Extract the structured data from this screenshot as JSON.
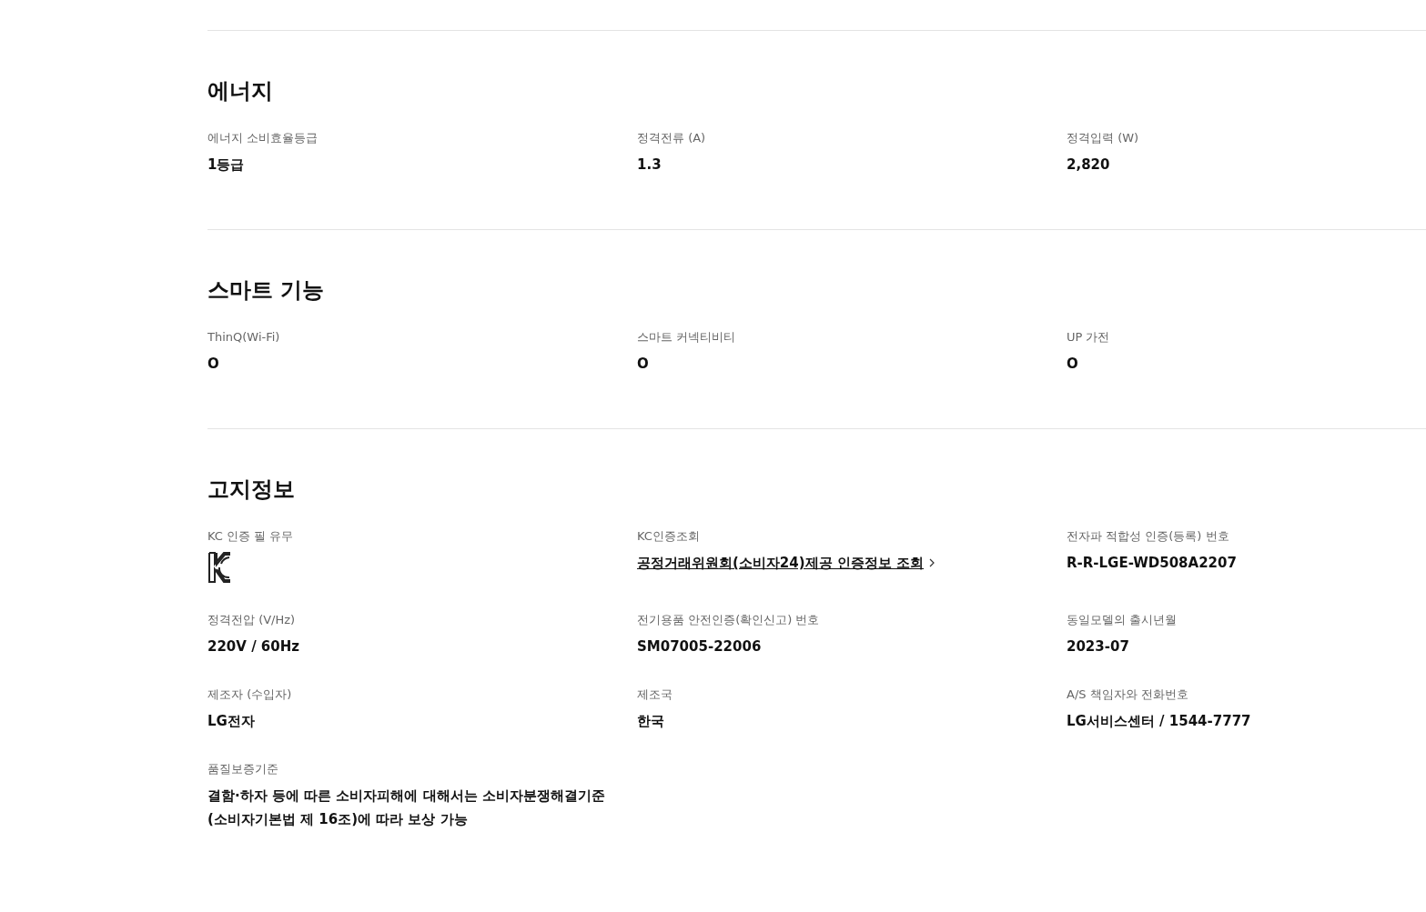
{
  "sections": [
    {
      "title": "에너지",
      "items": [
        {
          "kind": "text",
          "label": "에너지 소비효율등급",
          "value": "1등급"
        },
        {
          "kind": "text",
          "label": "정격전류 (A)",
          "value": "1.3"
        },
        {
          "kind": "text",
          "label": "정격입력 (W)",
          "value": "2,820"
        }
      ]
    },
    {
      "title": "스마트 기능",
      "items": [
        {
          "kind": "text",
          "label": "ThinQ(Wi-Fi)",
          "value": "O"
        },
        {
          "kind": "text",
          "label": "스마트 커넥티비티",
          "value": "O"
        },
        {
          "kind": "text",
          "label": "UP 가전",
          "value": "O"
        }
      ]
    },
    {
      "title": "고지정보",
      "items": [
        {
          "kind": "mark",
          "label": "KC 인증 필 유무"
        },
        {
          "kind": "link",
          "label": "KC인증조회",
          "value": "공정거래위원회(소비자24)제공 인증정보 조회"
        },
        {
          "kind": "text",
          "label": "전자파 적합성 인증(등록) 번호",
          "value": "R-R-LGE-WD508A2207"
        },
        {
          "kind": "text",
          "label": "정격전압 (V/Hz)",
          "value": "220V / 60Hz"
        },
        {
          "kind": "text",
          "label": "전기용품 안전인증(확인신고) 번호",
          "value": "SM07005-22006"
        },
        {
          "kind": "text",
          "label": "동일모델의 출시년월",
          "value": "2023-07"
        },
        {
          "kind": "text",
          "label": "제조자 (수입자)",
          "value": "LG전자"
        },
        {
          "kind": "text",
          "label": "제조국",
          "value": "한국"
        },
        {
          "kind": "text",
          "label": "A/S 책임자와 전화번호",
          "value": "LG서비스센터 / 1544-7777"
        },
        {
          "kind": "text",
          "label": "품질보증기준",
          "value": "결함·하자 등에 따른 소비자피해에 대해서는 소비자분쟁해결기준 (소비자기본법 제 16조)에 따라 보상 가능"
        }
      ]
    }
  ]
}
